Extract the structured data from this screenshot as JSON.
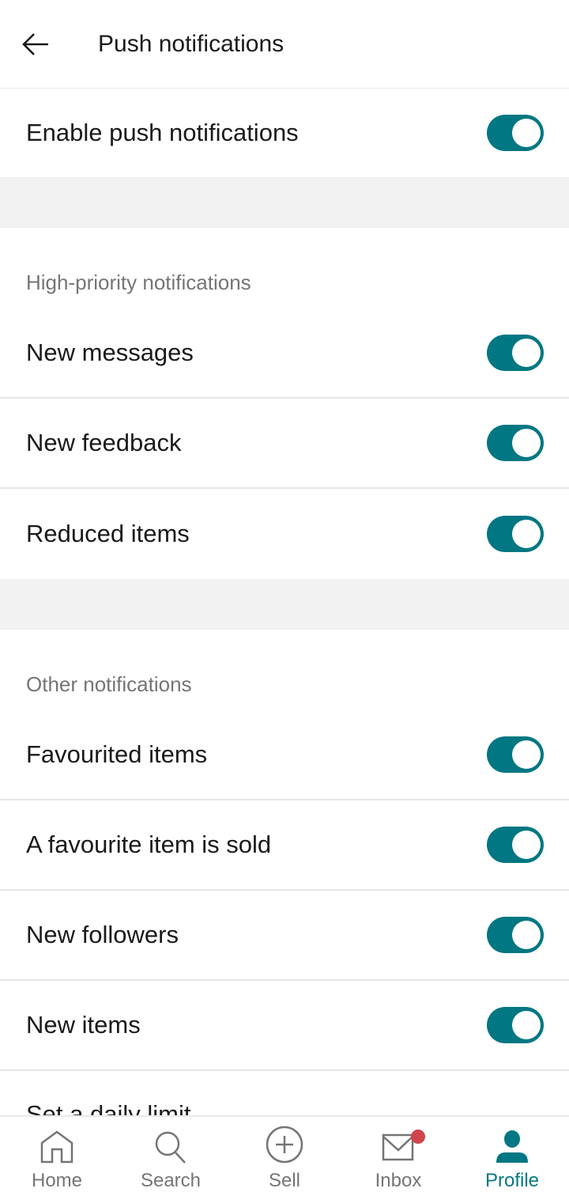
{
  "header": {
    "title": "Push notifications",
    "back_icon": "arrow-left-icon"
  },
  "enable": {
    "label": "Enable push notifications",
    "on": true
  },
  "sections": [
    {
      "title": "High-priority notifications",
      "items": [
        {
          "label": "New messages",
          "on": true
        },
        {
          "label": "New feedback",
          "on": true
        },
        {
          "label": "Reduced items",
          "on": true
        }
      ]
    },
    {
      "title": "Other notifications",
      "items": [
        {
          "label": "Favourited items",
          "on": true
        },
        {
          "label": "A favourite item is sold",
          "on": true
        },
        {
          "label": "New followers",
          "on": true
        },
        {
          "label": "New items",
          "on": true
        }
      ]
    }
  ],
  "daily_limit": {
    "label": "Set a daily limit"
  },
  "nav": {
    "items": [
      {
        "label": "Home",
        "icon": "home-icon"
      },
      {
        "label": "Search",
        "icon": "search-icon"
      },
      {
        "label": "Sell",
        "icon": "plus-circle-icon"
      },
      {
        "label": "Inbox",
        "icon": "mail-icon",
        "badge": true
      },
      {
        "label": "Profile",
        "icon": "person-icon",
        "active": true
      }
    ]
  },
  "colors": {
    "accent": "#007782",
    "badge": "#d0454c"
  }
}
